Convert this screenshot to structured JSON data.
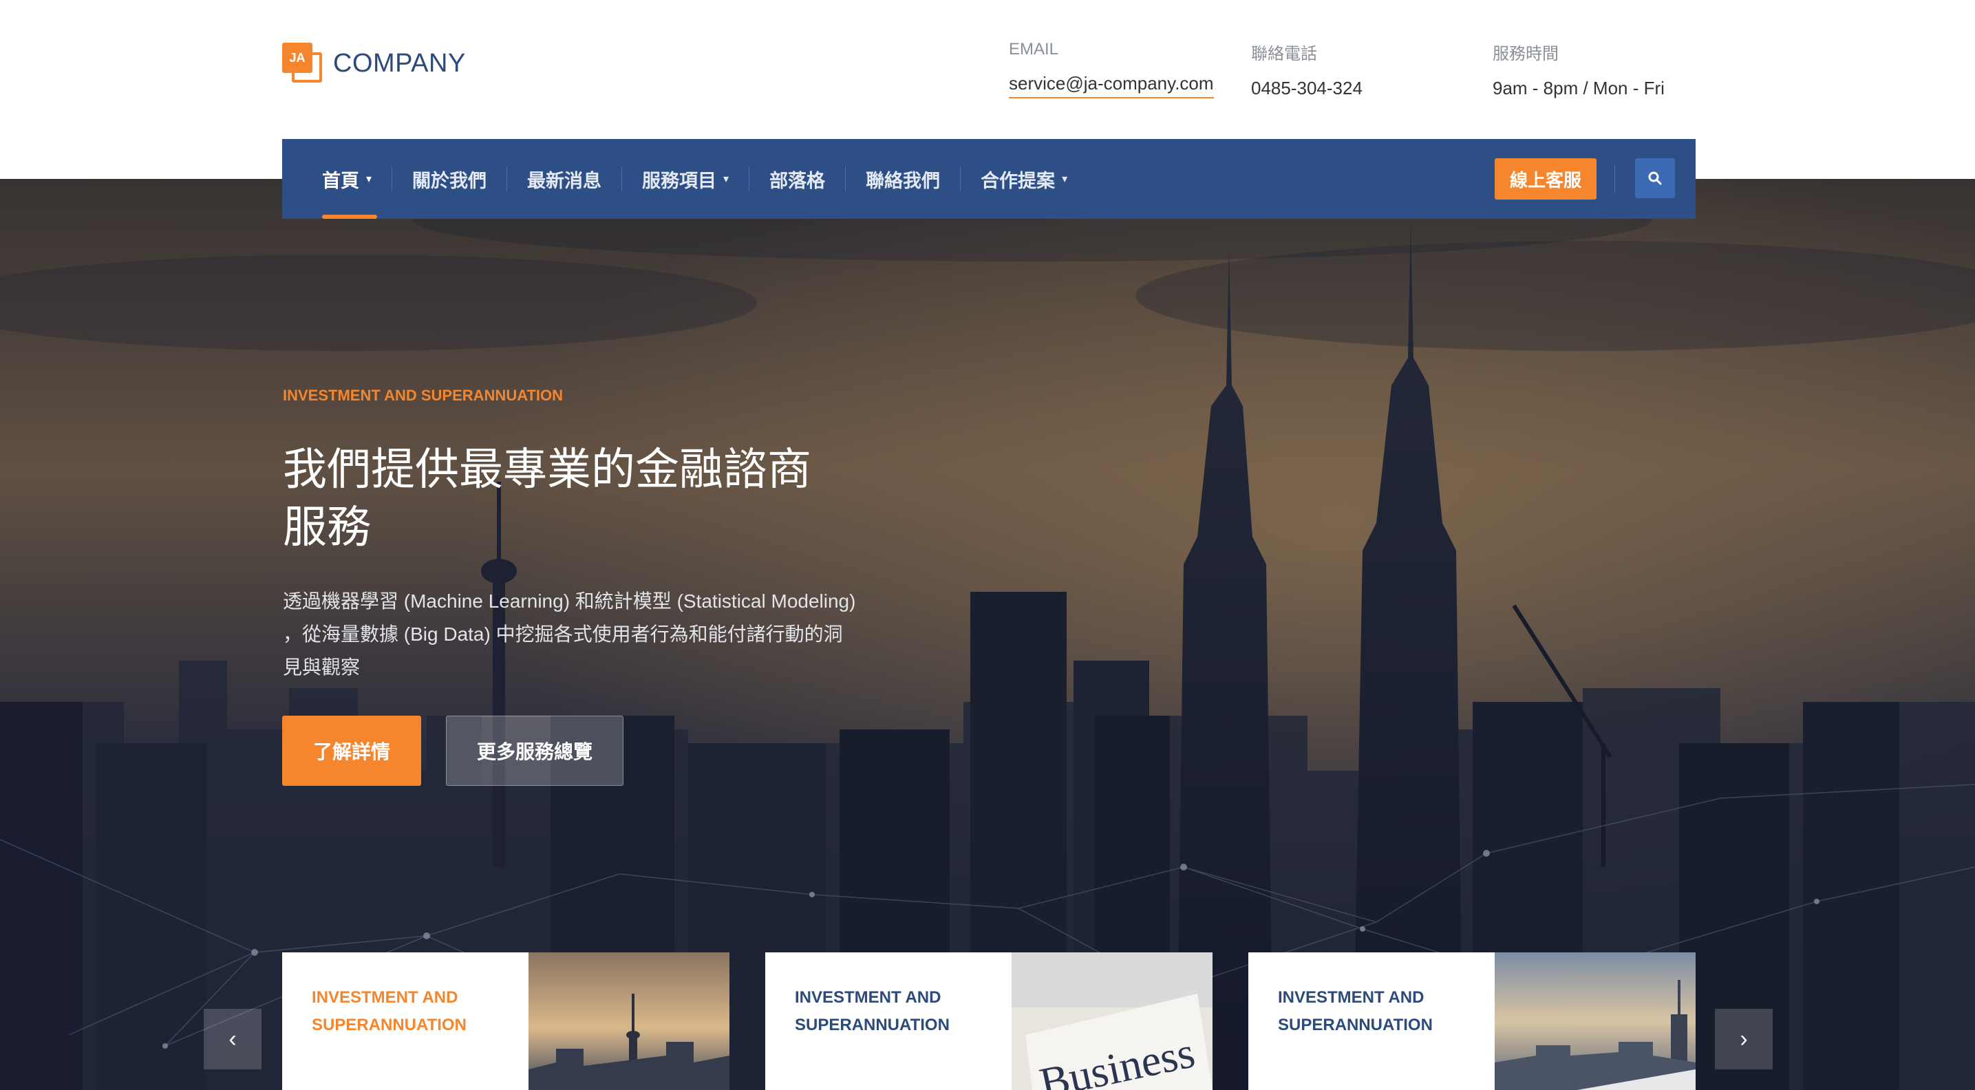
{
  "logo": {
    "mark_text": "JA",
    "text": "COMPANY"
  },
  "contact": {
    "email_label": "EMAIL",
    "email_value": "service@ja-company.com",
    "phone_label": "聯絡電話",
    "phone_value": "0485-304-324",
    "hours_label": "服務時間",
    "hours_value": "9am - 8pm / Mon - Fri"
  },
  "nav": {
    "items": [
      {
        "label": "首頁",
        "dropdown": true
      },
      {
        "label": "關於我們",
        "dropdown": false
      },
      {
        "label": "最新消息",
        "dropdown": false
      },
      {
        "label": "服務項目",
        "dropdown": true
      },
      {
        "label": "部落格",
        "dropdown": false
      },
      {
        "label": "聯絡我們",
        "dropdown": false
      },
      {
        "label": "合作提案",
        "dropdown": true
      }
    ],
    "caret": "▾",
    "cta_label": "線上客服",
    "search_icon": "search-icon"
  },
  "hero": {
    "tag": "INVESTMENT AND SUPERANNUATION",
    "title": "我們提供最專業的金融諮商服務",
    "description": "透過機器學習 (Machine Learning) 和統計模型 (Statistical Modeling) ，從海量數據 (Big Data) 中挖掘各式使用者行為和能付諸行動的洞見與觀察",
    "primary_button": "了解詳情",
    "secondary_button": "更多服務總覽"
  },
  "cards": [
    {
      "title": "INVESTMENT AND SUPERANNUATION",
      "image": "city-tower-sunset-image"
    },
    {
      "title": "INVESTMENT AND SUPERANNUATION",
      "image": "business-newspaper-image"
    },
    {
      "title": "INVESTMENT AND SUPERANNUATION",
      "image": "city-skyline-image"
    }
  ],
  "carousel": {
    "prev_icon": "‹",
    "next_icon": "›"
  },
  "colors": {
    "accent": "#f5862e",
    "nav_bg": "#2d4f85",
    "brand_text": "#2c4a7a"
  }
}
